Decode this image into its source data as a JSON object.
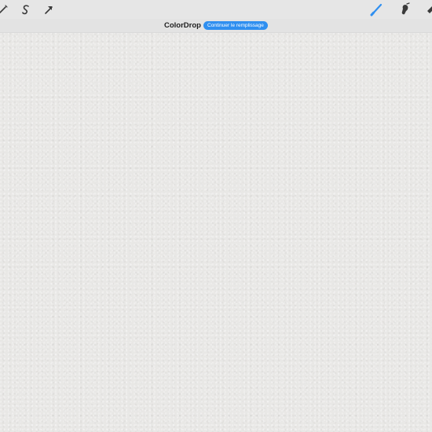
{
  "app": {
    "title": "ColorDrop",
    "fill_action": "Continuer le remplissage"
  },
  "toolbar": {
    "left_tools": [
      {
        "icon": "adjust-wand-icon"
      },
      {
        "icon": "selection-s-icon"
      },
      {
        "icon": "transform-arrow-icon"
      }
    ],
    "right_tools": [
      {
        "icon": "brush-icon",
        "active": true
      },
      {
        "icon": "smudge-icon"
      },
      {
        "icon": "eraser-icon"
      }
    ],
    "active_color": "#2f8ff0",
    "icon_color": "#3a3a3a"
  },
  "canvas": {
    "paper_color": "#ebeae8"
  }
}
